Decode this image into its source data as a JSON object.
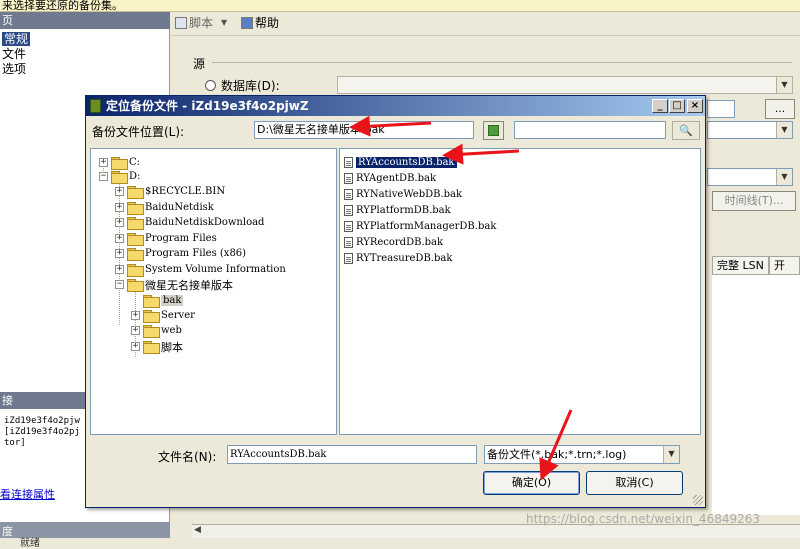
{
  "background": {
    "top_hint": "来选择要还原的备份集。",
    "left_panel": {
      "header_top": "页",
      "items": [
        "常规",
        "文件",
        "选项"
      ],
      "selected_index": 0,
      "header_conn": "接",
      "conn_lines": [
        "iZd19e3f4o2pjw",
        "[iZd19e3f4o2pj",
        "tor]"
      ],
      "link": "看连接属性",
      "header_progress": "度",
      "progress_text": "就绪"
    },
    "toolbar": {
      "script_label": "脚本",
      "help_label": "帮助"
    },
    "source_section": "源",
    "radio_database": "数据库(D):",
    "browse_button": "...",
    "timeline_button": "时间线(T)...",
    "grid_headers": [
      "完整 LSN",
      "开"
    ]
  },
  "dialog": {
    "title": "定位备份文件 - iZd19e3f4o2pjwZ",
    "location_label": "备份文件位置(L):",
    "location_value": "D:\\微星无名接单版本\\bak",
    "search_button": "...",
    "tree": [
      {
        "label": "C:",
        "expander": "+"
      },
      {
        "label": "D:",
        "expander": "−"
      },
      {
        "label": "$RECYCLE.BIN",
        "expander": "+"
      },
      {
        "label": "BaiduNetdisk",
        "expander": "+"
      },
      {
        "label": "BaiduNetdiskDownload",
        "expander": "+"
      },
      {
        "label": "Program Files",
        "expander": "+"
      },
      {
        "label": "Program Files (x86)",
        "expander": "+"
      },
      {
        "label": "System Volume Information",
        "expander": "+"
      },
      {
        "label": "微星无名接单版本",
        "expander": "−"
      },
      {
        "label": "bak",
        "expander": ""
      },
      {
        "label": "Server",
        "expander": "+"
      },
      {
        "label": "web",
        "expander": "+"
      },
      {
        "label": "脚本",
        "expander": "+"
      }
    ],
    "files": [
      "RYAccountsDB.bak",
      "RYAgentDB.bak",
      "RYNativeWebDB.bak",
      "RYPlatformDB.bak",
      "RYPlatformManagerDB.bak",
      "RYRecordDB.bak",
      "RYTreasureDB.bak"
    ],
    "selected_file_index": 0,
    "filename_label": "文件名(N):",
    "filename_value": "RYAccountsDB.bak",
    "filetype_value": "备份文件(*.bak;*.trn;*.log)",
    "ok_label": "确定(O)",
    "cancel_label": "取消(C)"
  },
  "watermark": "https://blog.csdn.net/weixin_46849263",
  "colors": {
    "annotation_arrow": "#e8141a",
    "selection": "#0a246a",
    "title_gradient_start": "#0a246a",
    "title_gradient_end": "#a6caf0"
  }
}
